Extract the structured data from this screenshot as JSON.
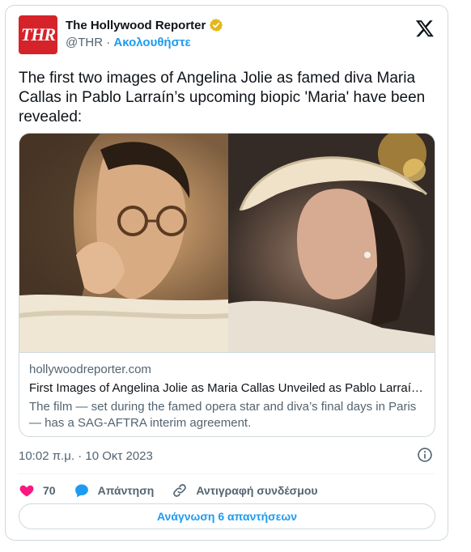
{
  "account": {
    "logo_text": "THR",
    "name": "The Hollywood Reporter",
    "handle": "@THR",
    "separator": "·",
    "follow_label": "Ακολουθήστε"
  },
  "tweet": {
    "text": "The first two images of Angelina Jolie as famed diva Maria Callas in Pablo Larraín’s upcoming biopic 'Maria' have been revealed:"
  },
  "link_card": {
    "domain": "hollywoodreporter.com",
    "title": "First Images of Angelina Jolie as Maria Callas Unveiled as Pablo Larraín’s...",
    "description": "The film — set during the famed opera star and diva’s final days in Paris — has a SAG-AFTRA interim agreement."
  },
  "meta": {
    "timestamp": "10:02 π.μ. · 10 Οκτ 2023"
  },
  "actions": {
    "like_count": "70",
    "reply_label": "Απάντηση",
    "copy_link_label": "Αντιγραφή συνδέσμου"
  },
  "read_replies_label": "Ανάγνωση 6 απαντήσεων",
  "colors": {
    "accent": "#1d9bf0",
    "like": "#f91880",
    "brand_logo": "#d6232a",
    "verified_gold": "#e2b719"
  }
}
